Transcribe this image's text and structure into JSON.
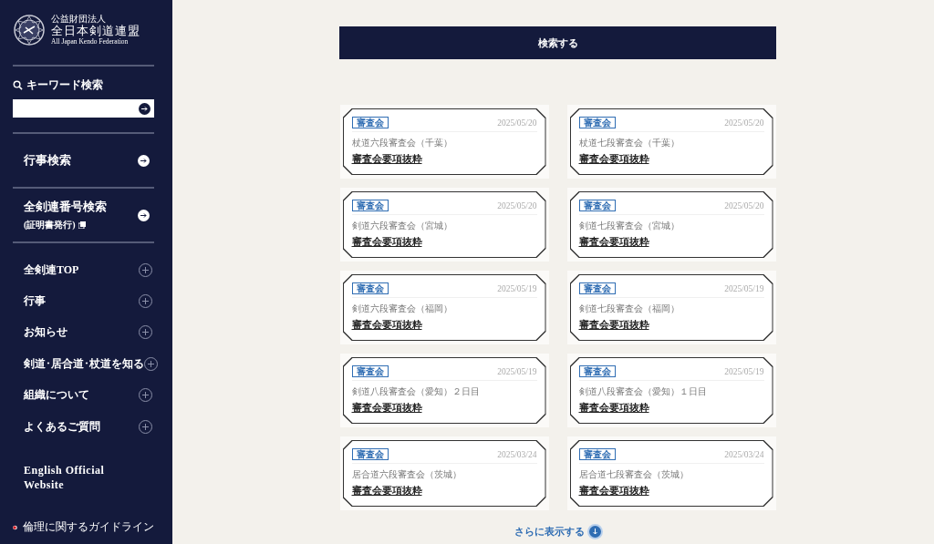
{
  "sidebar": {
    "logo": {
      "org_type": "公益財団法人",
      "name": "全日本剣道連盟",
      "name_en": "All Japan Kendo Federation"
    },
    "keyword_search": {
      "label": "キーワード検索"
    },
    "search_links": [
      {
        "label": "行事検索"
      },
      {
        "label": "全剣連番号検索",
        "sub": "(証明書発行)"
      }
    ],
    "menu": [
      {
        "label": "全剣連TOP",
        "expanded": false
      },
      {
        "label": "行事",
        "expanded": false
      },
      {
        "label": "お知らせ",
        "expanded": false
      },
      {
        "label": "剣道･居合道･杖道を知る",
        "expanded": false
      },
      {
        "label": "組織について",
        "expanded": false
      },
      {
        "label": "よくあるご質問",
        "expanded": false
      }
    ],
    "english_link": "English Official Website",
    "guideline_link": "倫理に関するガイドライン"
  },
  "search_button": "検索する",
  "results": [
    {
      "tag": "審査会",
      "date": "2025/05/20",
      "title": "杖道六段審査会（千葉）",
      "link": "審査会要項抜粋"
    },
    {
      "tag": "審査会",
      "date": "2025/05/20",
      "title": "杖道七段審査会（千葉）",
      "link": "審査会要項抜粋"
    },
    {
      "tag": "審査会",
      "date": "2025/05/20",
      "title": "剣道六段審査会（宮城）",
      "link": "審査会要項抜粋"
    },
    {
      "tag": "審査会",
      "date": "2025/05/20",
      "title": "剣道七段審査会（宮城）",
      "link": "審査会要項抜粋"
    },
    {
      "tag": "審査会",
      "date": "2025/05/19",
      "title": "剣道六段審査会（福岡）",
      "link": "審査会要項抜粋"
    },
    {
      "tag": "審査会",
      "date": "2025/05/19",
      "title": "剣道七段審査会（福岡）",
      "link": "審査会要項抜粋"
    },
    {
      "tag": "審査会",
      "date": "2025/05/19",
      "title": "剣道八段審査会（愛知）２日目",
      "link": "審査会要項抜粋"
    },
    {
      "tag": "審査会",
      "date": "2025/05/19",
      "title": "剣道八段審査会（愛知）１日目",
      "link": "審査会要項抜粋"
    },
    {
      "tag": "審査会",
      "date": "2025/03/24",
      "title": "居合道六段審査会（茨城）",
      "link": "審査会要項抜粋"
    },
    {
      "tag": "審査会",
      "date": "2025/03/24",
      "title": "居合道七段審査会（茨城）",
      "link": "審査会要項抜粋"
    }
  ],
  "load_more": "さらに表示する"
}
